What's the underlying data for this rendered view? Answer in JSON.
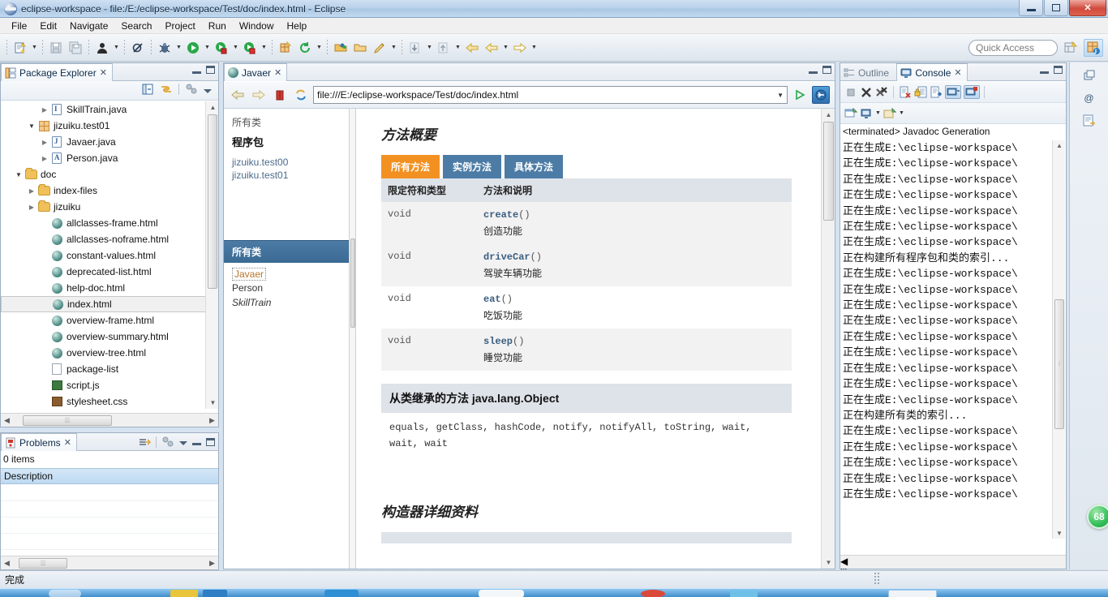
{
  "window": {
    "title": "eclipse-workspace - file:/E:/eclipse-workspace/Test/doc/index.html - Eclipse",
    "app_icon": "eclipse-icon",
    "minimize_label": "–",
    "maximize_label": "❐",
    "close_label": "✕"
  },
  "menubar": {
    "items": [
      {
        "label": "File"
      },
      {
        "label": "Edit"
      },
      {
        "label": "Navigate"
      },
      {
        "label": "Search"
      },
      {
        "label": "Project"
      },
      {
        "label": "Run"
      },
      {
        "label": "Window"
      },
      {
        "label": "Help"
      }
    ]
  },
  "toolbar": {
    "quick_access_placeholder": "Quick Access",
    "buttons": [
      {
        "name": "new-wizard-icon",
        "tooltip": "New"
      },
      {
        "name": "save-icon",
        "tooltip": "Save"
      },
      {
        "name": "save-all-icon",
        "tooltip": "Save All"
      },
      {
        "name": "user-icon",
        "tooltip": "Person"
      },
      {
        "name": "skip-breakpoints-icon",
        "tooltip": "Skip All Breakpoints"
      },
      {
        "name": "debug-icon",
        "tooltip": "Debug"
      },
      {
        "name": "run-icon",
        "tooltip": "Run"
      },
      {
        "name": "run-external-tools-icon",
        "tooltip": "External Tools"
      },
      {
        "name": "coverage-icon",
        "tooltip": "Coverage"
      },
      {
        "name": "new-java-project-icon",
        "tooltip": "New Java Project"
      },
      {
        "name": "refresh-icon",
        "tooltip": "Refresh"
      },
      {
        "name": "open-type-icon",
        "tooltip": "Open Type"
      },
      {
        "name": "open-task-icon",
        "tooltip": "Open Task"
      },
      {
        "name": "search-pencil-icon",
        "tooltip": "Search"
      },
      {
        "name": "next-annotation-icon",
        "tooltip": "Next Annotation"
      },
      {
        "name": "previous-annotation-icon",
        "tooltip": "Previous Annotation"
      },
      {
        "name": "back-icon",
        "tooltip": "Back"
      },
      {
        "name": "forward-icon",
        "tooltip": "Forward"
      }
    ],
    "perspective_buttons": [
      {
        "name": "open-perspective-icon"
      },
      {
        "name": "java-perspective-icon"
      }
    ]
  },
  "package_explorer": {
    "title": "Package Explorer",
    "close_label": "✕",
    "toolbar_icons": [
      "collapse-all-icon",
      "link-with-editor-icon",
      "focus-on-active-task-icon",
      "view-menu-icon"
    ],
    "tree": [
      {
        "label": "SkillTrain.java",
        "icon": "java-interface-icon",
        "indent": 3,
        "arrow": "collapsed",
        "selected": false
      },
      {
        "label": "jizuiku.test01",
        "icon": "package-icon",
        "indent": 2,
        "arrow": "expanded",
        "selected": false
      },
      {
        "label": "Javaer.java",
        "icon": "java-file-icon",
        "indent": 3,
        "arrow": "collapsed",
        "selected": false
      },
      {
        "label": "Person.java",
        "icon": "java-abstract-icon",
        "indent": 3,
        "arrow": "collapsed",
        "selected": false
      },
      {
        "label": "doc",
        "icon": "folder-icon",
        "indent": 1,
        "arrow": "expanded",
        "selected": false
      },
      {
        "label": "index-files",
        "icon": "folder-icon",
        "indent": 2,
        "arrow": "collapsed",
        "selected": false
      },
      {
        "label": "jizuiku",
        "icon": "folder-icon",
        "indent": 2,
        "arrow": "collapsed",
        "selected": false
      },
      {
        "label": "allclasses-frame.html",
        "icon": "html-icon",
        "indent": 3,
        "arrow": "none",
        "selected": false
      },
      {
        "label": "allclasses-noframe.html",
        "icon": "html-icon",
        "indent": 3,
        "arrow": "none",
        "selected": false
      },
      {
        "label": "constant-values.html",
        "icon": "html-icon",
        "indent": 3,
        "arrow": "none",
        "selected": false
      },
      {
        "label": "deprecated-list.html",
        "icon": "html-icon",
        "indent": 3,
        "arrow": "none",
        "selected": false
      },
      {
        "label": "help-doc.html",
        "icon": "html-icon",
        "indent": 3,
        "arrow": "none",
        "selected": false
      },
      {
        "label": "index.html",
        "icon": "html-icon",
        "indent": 3,
        "arrow": "none",
        "selected": true
      },
      {
        "label": "overview-frame.html",
        "icon": "html-icon",
        "indent": 3,
        "arrow": "none",
        "selected": false
      },
      {
        "label": "overview-summary.html",
        "icon": "html-icon",
        "indent": 3,
        "arrow": "none",
        "selected": false
      },
      {
        "label": "overview-tree.html",
        "icon": "html-icon",
        "indent": 3,
        "arrow": "none",
        "selected": false
      },
      {
        "label": "package-list",
        "icon": "text-file-icon",
        "indent": 3,
        "arrow": "none",
        "selected": false
      },
      {
        "label": "script.js",
        "icon": "js-file-icon",
        "indent": 3,
        "arrow": "none",
        "selected": false
      },
      {
        "label": "stylesheet.css",
        "icon": "css-file-icon",
        "indent": 3,
        "arrow": "none",
        "selected": false
      }
    ]
  },
  "problems": {
    "title": "Problems",
    "close_label": "✕",
    "items_count_label": "0 items",
    "column_header": "Description",
    "toolbar_icons": [
      "focus-on-selection-icon",
      "focus-on-active-task-icon",
      "view-menu-icon"
    ]
  },
  "editor": {
    "tab_label": "Javaer",
    "tab_icon": "html-icon",
    "close_label": "✕",
    "url": "file:///E:/eclipse-workspace/Test/doc/index.html",
    "nav_icons": [
      "back-icon",
      "forward-icon",
      "stop-icon",
      "refresh-icon"
    ],
    "go_icon": "go-icon",
    "open-external-icon": "open-external-browser-icon",
    "dropdown_icon": "chevron-down-icon"
  },
  "javadoc": {
    "left_frame": {
      "all_classes_top": "所有类",
      "packages_heading": "程序包",
      "packages": [
        "jizuiku.test00",
        "jizuiku.test01"
      ],
      "all_classes_bar": "所有类",
      "classes": [
        {
          "name": "Javaer",
          "style": "current"
        },
        {
          "name": "Person",
          "style": "normal"
        },
        {
          "name": "SkillTrain",
          "style": "italic"
        }
      ]
    },
    "method_summary": {
      "heading": "方法概要",
      "tabs": [
        {
          "label": "所有方法",
          "active": true
        },
        {
          "label": "实例方法",
          "active": false
        },
        {
          "label": "具体方法",
          "active": false
        }
      ],
      "columns": [
        "限定符和类型",
        "方法和说明"
      ],
      "rows": [
        {
          "type": "void",
          "method": "create",
          "parens": "()",
          "desc": "创造功能"
        },
        {
          "type": "void",
          "method": "driveCar",
          "parens": "()",
          "desc": "驾驶车辆功能"
        },
        {
          "type": "void",
          "method": "eat",
          "parens": "()",
          "desc": "吃饭功能"
        },
        {
          "type": "void",
          "method": "sleep",
          "parens": "()",
          "desc": "睡觉功能"
        }
      ]
    },
    "inherited": {
      "heading_cn": "从类继承的方法 ",
      "heading_class": "java.lang.Object",
      "methods": "equals, getClass, hashCode, notify, notifyAll, toString, wait, wait, wait"
    },
    "constructor_detail_heading": "构造器详细资料"
  },
  "right_panel": {
    "tabs": [
      {
        "label": "Outline",
        "icon": "outline-icon",
        "active": false
      },
      {
        "label": "Console",
        "icon": "console-icon",
        "active": true
      }
    ],
    "close_label": "✕",
    "toolbar_row1": [
      "terminate-icon",
      "remove-launch-icon",
      "remove-all-terminated-icon",
      "clear-console-icon",
      "scroll-lock-icon",
      "show-console-on-output-icon",
      "pin-console-icon",
      "display-selected-console-icon"
    ],
    "toolbar_row2": [
      "new-console-view-icon",
      "display-selected-console-dropdown-icon",
      "open-console-dropdown-icon"
    ],
    "terminated_label": "<terminated> Javadoc Generation",
    "console_lines": [
      "正在生成E:\\eclipse-workspace\\",
      "正在生成E:\\eclipse-workspace\\",
      "正在生成E:\\eclipse-workspace\\",
      "正在生成E:\\eclipse-workspace\\",
      "正在生成E:\\eclipse-workspace\\",
      "正在生成E:\\eclipse-workspace\\",
      "正在生成E:\\eclipse-workspace\\",
      "正在构建所有程序包和类的索引...",
      "正在生成E:\\eclipse-workspace\\",
      "正在生成E:\\eclipse-workspace\\",
      "正在生成E:\\eclipse-workspace\\",
      "正在生成E:\\eclipse-workspace\\",
      "正在生成E:\\eclipse-workspace\\",
      "正在生成E:\\eclipse-workspace\\",
      "正在生成E:\\eclipse-workspace\\",
      "正在生成E:\\eclipse-workspace\\",
      "正在生成E:\\eclipse-workspace\\",
      "正在构建所有类的索引...",
      "正在生成E:\\eclipse-workspace\\",
      "正在生成E:\\eclipse-workspace\\",
      "正在生成E:\\eclipse-workspace\\",
      "正在生成E:\\eclipse-workspace\\",
      "正在生成E:\\eclipse-workspace\\"
    ]
  },
  "right_strip": {
    "buttons": [
      "restore-outline-icon",
      "at-sign-icon",
      "javadoc-view-icon"
    ]
  },
  "statusbar": {
    "message": "完成"
  },
  "badge": {
    "value": "68"
  },
  "colors": {
    "accent_orange": "#f29121",
    "accent_blue": "#4c7ca5",
    "selection_blue": "#bed9f1",
    "title_gradient_start": "#cfe0f2"
  }
}
